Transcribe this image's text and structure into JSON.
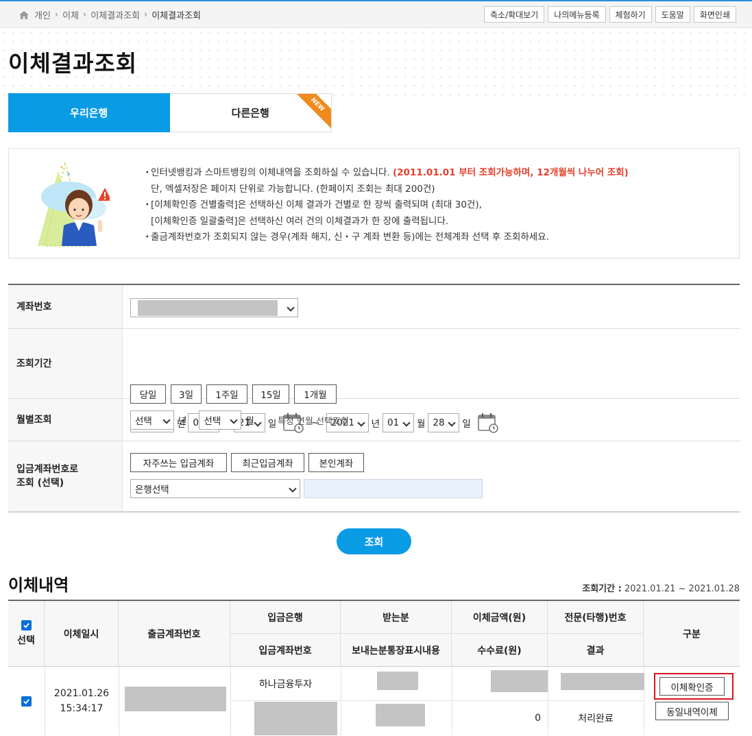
{
  "breadcrumb": [
    "개인",
    "이체",
    "이체결과조회",
    "이체결과조회"
  ],
  "top_buttons": [
    "축소/확대보기",
    "나의메뉴등록",
    "체험하기",
    "도움말",
    "화면인쇄"
  ],
  "page_title": "이체결과조회",
  "tabs": {
    "woori": "우리은행",
    "other": "다른은행",
    "new_badge": "NEW"
  },
  "notice": {
    "line1a": "인터넷뱅킹과 스마트뱅킹의 이체내역을 조회하실 수 있습니다.",
    "line1b": "(2011.01.01 부터 조회가능하며, 12개월씩 나누어 조회)",
    "line2": "단, 엑셀저장은 페이지 단위로 가능합니다. (한페이지 조회는 최대 200건)",
    "line3": "[이체확인증 건별출력]은 선택하신 이체 결과가 건별로 한 장씩 출력되며 (최대 30건),",
    "line4": "[이체확인증 일괄출력]은 선택하신 여러 건의 이체결과가 한 장에 출력됩니다.",
    "line5": "출금계좌번호가 조회되지 않는 경우(계좌 해지, 신・구 계좌 변환 등)에는 전체계좌 선택 후 조회하세요."
  },
  "form": {
    "account_label": "계좌번호",
    "account_value": "",
    "period_label": "조회기간",
    "quick_buttons": [
      "당일",
      "3일",
      "1주일",
      "15일",
      "1개월"
    ],
    "from": {
      "year": "2021",
      "month": "01",
      "day": "21"
    },
    "to": {
      "year": "2021",
      "month": "01",
      "day": "28"
    },
    "unit_year": "년",
    "unit_month": "월",
    "unit_day": "일",
    "tilde": "~",
    "monthly_label": "월별조회",
    "monthly_year": "선택",
    "monthly_month": "선택",
    "monthly_hint": "특정 연월 선택조회",
    "deposit_label_1": "입금계좌번호로",
    "deposit_label_2": "조회 (선택)",
    "deposit_buttons": [
      "자주쓰는 입금계좌",
      "최근입금계좌",
      "본인계좌"
    ],
    "bank_select": "은행선택",
    "deposit_input": ""
  },
  "search_button": "조회",
  "results": {
    "title": "이체내역",
    "period_label": "조회기간 :",
    "period_value": "2021.01.21 ~ 2021.01.28",
    "headers": {
      "select": "선택",
      "datetime": "이체일시",
      "from_account": "출금계좌번호",
      "bank": "입금은행",
      "to_account": "입금계좌번호",
      "recipient": "받는분",
      "sender_memo": "보내는분통장표시내용",
      "amount": "이체금액(원)",
      "fee": "수수료(원)",
      "ref_no": "전문(타행)번호",
      "result": "결과",
      "category": "구분"
    },
    "row": {
      "date": "2021.01.26",
      "time": "15:34:17",
      "bank": "하나금융투자",
      "fee": "0",
      "result": "처리완료",
      "btn_confirm": "이체확인증",
      "btn_repeat": "동일내역이체"
    }
  },
  "colors": {
    "accent": "#0a9be5",
    "notice_red": "#e4402b",
    "new_badge": "#f08a1c",
    "highlight_border": "#d9121b"
  }
}
